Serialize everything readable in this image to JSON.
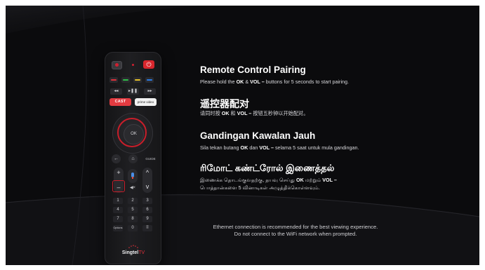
{
  "remote": {
    "cast_label": "CAST",
    "prime_label": "prime video",
    "ok_label": "OK",
    "guide_label": "GUIDE",
    "rewind_label": "◂◂",
    "play_pause_label": "▸❚❚",
    "forward_label": "▸▸",
    "vol_up_label": "+",
    "vol_down_label": "–",
    "ch_up_label": "^",
    "ch_down_label": "v",
    "mute_label": "◀×",
    "back_label": "←",
    "home_label": "⌂",
    "numbers": [
      "1",
      "2",
      "3",
      "4",
      "5",
      "6",
      "7",
      "8",
      "9"
    ],
    "options_label": "Options",
    "zero_label": "0",
    "grid_label": "⠿",
    "brand_name": "Singtel",
    "brand_suffix": "TV"
  },
  "sections": {
    "english": {
      "title": "Remote Control Pairing",
      "pre": "Please hold the ",
      "key1": "OK",
      "mid": " & ",
      "key2": "VOL –",
      "post": " buttons for 5 seconds to start pairing."
    },
    "chinese": {
      "title": "遥控器配对",
      "pre": "请同时按 ",
      "key1": "OK",
      "mid": " 和 ",
      "key2": "VOL –",
      "post": " 按钮五秒钟以开始配对。"
    },
    "malay": {
      "title": "Gandingan Kawalan Jauh",
      "pre": "Sila tekan butang ",
      "key1": "OK",
      "mid": " dan ",
      "key2": "VOL –",
      "post": " selama 5 saat untuk mula gandingan."
    },
    "tamil": {
      "title": "ரிமோட் கண்ட்ரோல் இணைத்தல்",
      "pre": "இணைக்க தொடங்குவதற்கு, தயவு செய்து ",
      "key1": "OK",
      "mid": " மற்றும் ",
      "key2": "VOL –",
      "line2": "பொத்தான்களை 5 வினாடிகள் அழுத்திக்கொள்ளவும்."
    }
  },
  "footer": {
    "line1": "Ethernet connection is recommended for the best viewing experience.",
    "line2": "Do not connect to the WiFi network when prompted."
  },
  "colors": {
    "background": "#0b0b0d",
    "accent_red": "#c81e2a",
    "cast_red": "#e33b41"
  }
}
